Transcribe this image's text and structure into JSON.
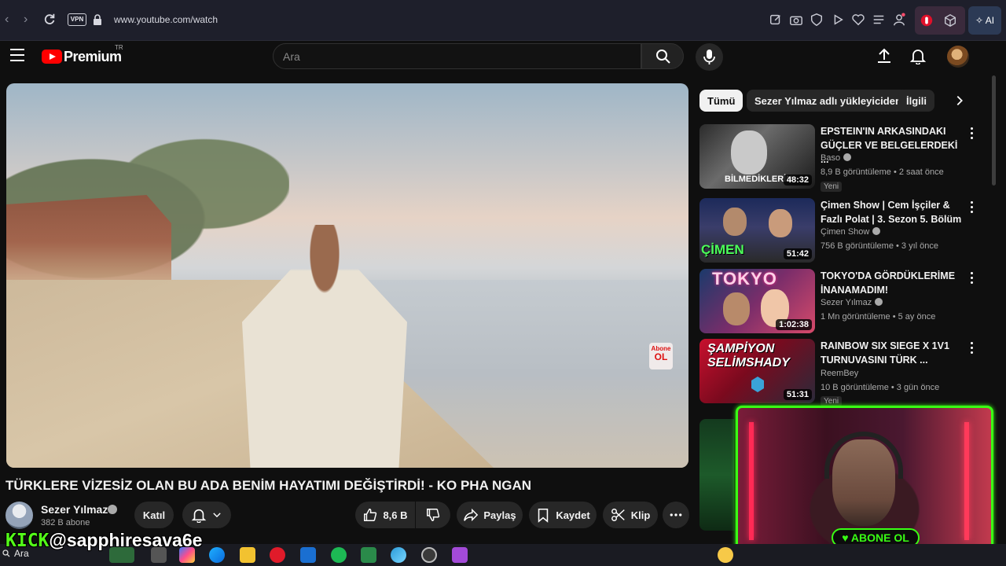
{
  "browser": {
    "vpn_label": "VPN",
    "url": "www.youtube.com/watch",
    "ai_label": "AI"
  },
  "header": {
    "logo_text": "Premium",
    "country_code": "TR",
    "search_placeholder": "Ara"
  },
  "video": {
    "title": "TÜRKLERE VİZESİZ OLAN BU ADA BENİM HAYATIMI DEĞİŞTİRDİ! - KO PHA NGAN",
    "badge_top": "Abone",
    "badge_bottom": "OL",
    "channel": "Sezer Yılmaz",
    "subscribers": "382 B abone",
    "join_label": "Katıl",
    "likes": "8,6 B",
    "share_label": "Paylaş",
    "save_label": "Kaydet",
    "clip_label": "Klip"
  },
  "chips": [
    "Tümü",
    "Sezer Yılmaz adlı yükleyiciden",
    "İlgili"
  ],
  "recommendations": [
    {
      "title": "EPSTEIN'IN ARKASINDAKI GÜÇLER VE BELGELERDEKİ ...",
      "channel": "Baso",
      "meta": "8,9 B görüntüleme • 2 saat önce",
      "badge": "Yeni",
      "duration": "48:32",
      "thumb_text": "BİLMEDİKLERİN"
    },
    {
      "title": "Çimen Show | Cem İşçiler & Fazlı Polat | 3. Sezon 5. Bölüm",
      "channel": "Çimen Show",
      "meta": "756 B görüntüleme • 3 yıl önce",
      "duration": "51:42",
      "thumb_text": "ÇİMEN"
    },
    {
      "title": "TOKYO'DA GÖRDÜKLERİME İNANAMADIM!",
      "channel": "Sezer Yılmaz",
      "meta": "1 Mn görüntüleme • 5 ay önce",
      "duration": "1:02:38",
      "thumb_text": "TOKYO"
    },
    {
      "title": "RAINBOW SIX SIEGE X 1V1 TURNUVASINI TÜRK ...",
      "channel": "ReemBey",
      "meta": "10 B görüntüleme • 3 gün önce",
      "badge": "Yeni",
      "duration": "51:31",
      "thumb_text": "ŞAMPİYON SELİMSHADY"
    }
  ],
  "stream": {
    "kick_brand": "KICK",
    "kick_handle": "@sapphiresava6e",
    "abone_ol": "ABONE OL"
  },
  "taskbar": {
    "search_label": "Ara"
  },
  "colors": {
    "youtube_red": "#ff0000",
    "kick_green": "#53fc18",
    "webcam_border": "#39ff14"
  }
}
